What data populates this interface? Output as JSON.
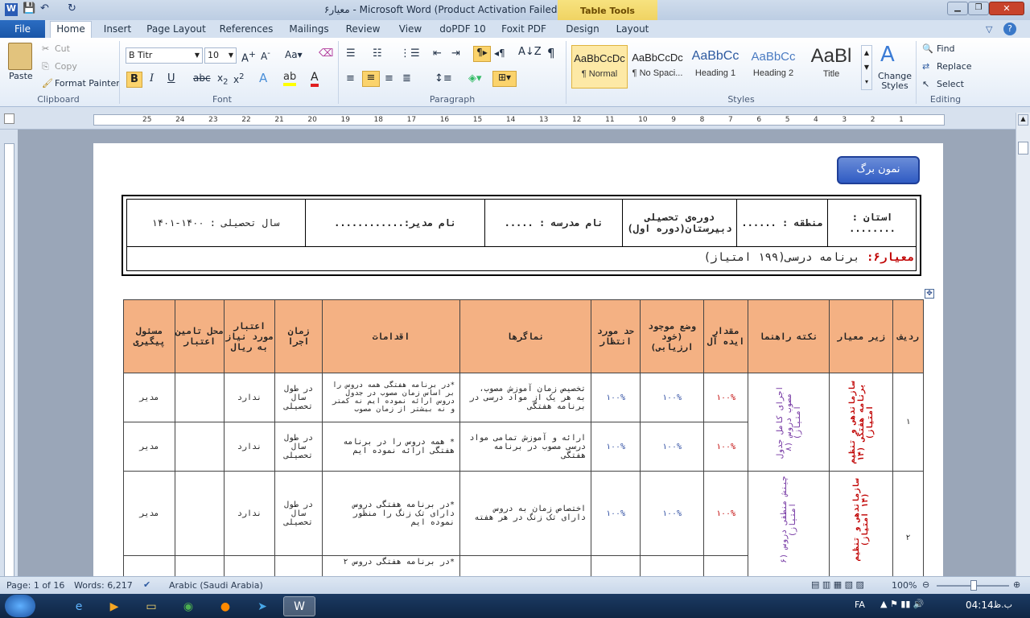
{
  "window": {
    "title": "معیار۶ - Microsoft Word (Product Activation Failed)"
  },
  "tabs": [
    "File",
    "Home",
    "Insert",
    "Page Layout",
    "References",
    "Mailings",
    "Review",
    "View",
    "doPDF 10",
    "Foxit PDF",
    "Design",
    "Layout"
  ],
  "table_tools": "Table Tools",
  "clipboard": {
    "paste": "Paste",
    "cut": "Cut",
    "copy": "Copy",
    "format_painter": "Format Painter",
    "label": "Clipboard"
  },
  "font": {
    "name": "B Titr",
    "size": "10",
    "label": "Font"
  },
  "paragraph": {
    "label": "Paragraph"
  },
  "styles": {
    "items": [
      {
        "sample": "AaBbCcDc",
        "name": "¶ Normal"
      },
      {
        "sample": "AaBbCcDc",
        "name": "¶ No Spaci..."
      },
      {
        "sample": "AaBbCc",
        "name": "Heading 1"
      },
      {
        "sample": "AaBbCc",
        "name": "Heading 2"
      },
      {
        "sample": "AaBl",
        "name": "Title"
      }
    ],
    "change": "Change Styles",
    "label": "Styles"
  },
  "editing": {
    "find": "Find",
    "replace": "Replace",
    "select": "Select",
    "label": "Editing"
  },
  "ruler": {
    "ticks": [
      "25",
      "24",
      "23",
      "22",
      "21",
      "20",
      "19",
      "18",
      "17",
      "16",
      "15",
      "14",
      "13",
      "12",
      "11",
      "10",
      "9",
      "8",
      "7",
      "6",
      "5",
      "4",
      "3",
      "2",
      "1"
    ]
  },
  "doc": {
    "badge": "نمون برگ",
    "header": {
      "province": "استان : ........",
      "region": "منطقه : ......",
      "course": "دوره‌ی تحصیلی دبیرستان(دوره اول)",
      "school": "نام مدرسه : .....",
      "manager": "نام مدیر:............",
      "year": "سال تحصیلی : ۱۴۰۰-۱۴۰۱"
    },
    "criterion_label": "معیار۶:",
    "criterion_text": "برنامه درسی(۱۹۹ امتیاز)",
    "table_headers": [
      "ردیف",
      "زیر معیار",
      "نکته راهنما",
      "مقدار ایده آل",
      "وضع موجود (خود ارزیابی)",
      "حد مورد انتظار",
      "نماگرها",
      "اقدامات",
      "زمان اجرا",
      "اعتبار مورد نیاز به ریال",
      "محل تامین اعتبار",
      "مسئول پیگیری"
    ],
    "rows": [
      {
        "idx": "۱",
        "sub": "سازماندهی و تنظیم برنامه هفتگی (۱۴ امتیاز)",
        "note": "اجرای کامل جدول مصوب دروس (۸ امتیاز)",
        "ideal": "۱۰۰%",
        "current": "۱۰۰%",
        "expected": "۱۰۰%",
        "indicator": "تخصیص زمان آموزش مصوب، به هر یک از مواد درسی در برنامه هفتگی",
        "action": "*در برنامه هفتگی همه دروس را بر اساس زمان مصوب در جدول دروس ارائه نموده ایم نه کمتر و نه بیشتر از زمان مصوب",
        "time": "در طول سال تحصیلی",
        "credit": "ندارد",
        "source": "",
        "resp": "مدیر"
      },
      {
        "idx": "",
        "sub": "",
        "note": "",
        "ideal": "۱۰۰%",
        "current": "۱۰۰%",
        "expected": "۱۰۰%",
        "indicator": "ارائه و آموزش تمامی مواد درسی مصوب در برنامه هفتگی",
        "action": "* همه دروس را در برنامه هفتگی ارائه نموده ایم",
        "time": "در طول سال تحصیلی",
        "credit": "ندارد",
        "source": "",
        "resp": "مدیر"
      },
      {
        "idx": "۲",
        "sub": "سازماندهی و تنظیم (۱۴ امتیاز)",
        "note": "چینش منطقی دروس (۶ امتیاز)",
        "ideal": "۱۰۰%",
        "current": "۱۰۰%",
        "expected": "۱۰۰%",
        "indicator": "اختصاص زمان به دروس دارای تک زنگ در هر هفته",
        "action": "*در برنامه هفتگی دروس دارای تک زنگ را منظور نموده ایم",
        "time": "در طول سال تحصیلی",
        "credit": "ندارد",
        "source": "",
        "resp": "مدیر"
      },
      {
        "idx": "",
        "sub": "",
        "note": "",
        "ideal": "",
        "current": "",
        "expected": "",
        "indicator": "",
        "action": "*در برنامه هفتگی دروس ۲",
        "time": "",
        "credit": "",
        "source": "",
        "resp": ""
      }
    ]
  },
  "status": {
    "page": "Page: 1 of 16",
    "words": "Words: 6,217",
    "lang": "Arabic (Saudi Arabia)",
    "zoom": "100%"
  },
  "taskbar": {
    "lang": "FA",
    "time": "04:14",
    "ampm": "ب.ظ"
  }
}
